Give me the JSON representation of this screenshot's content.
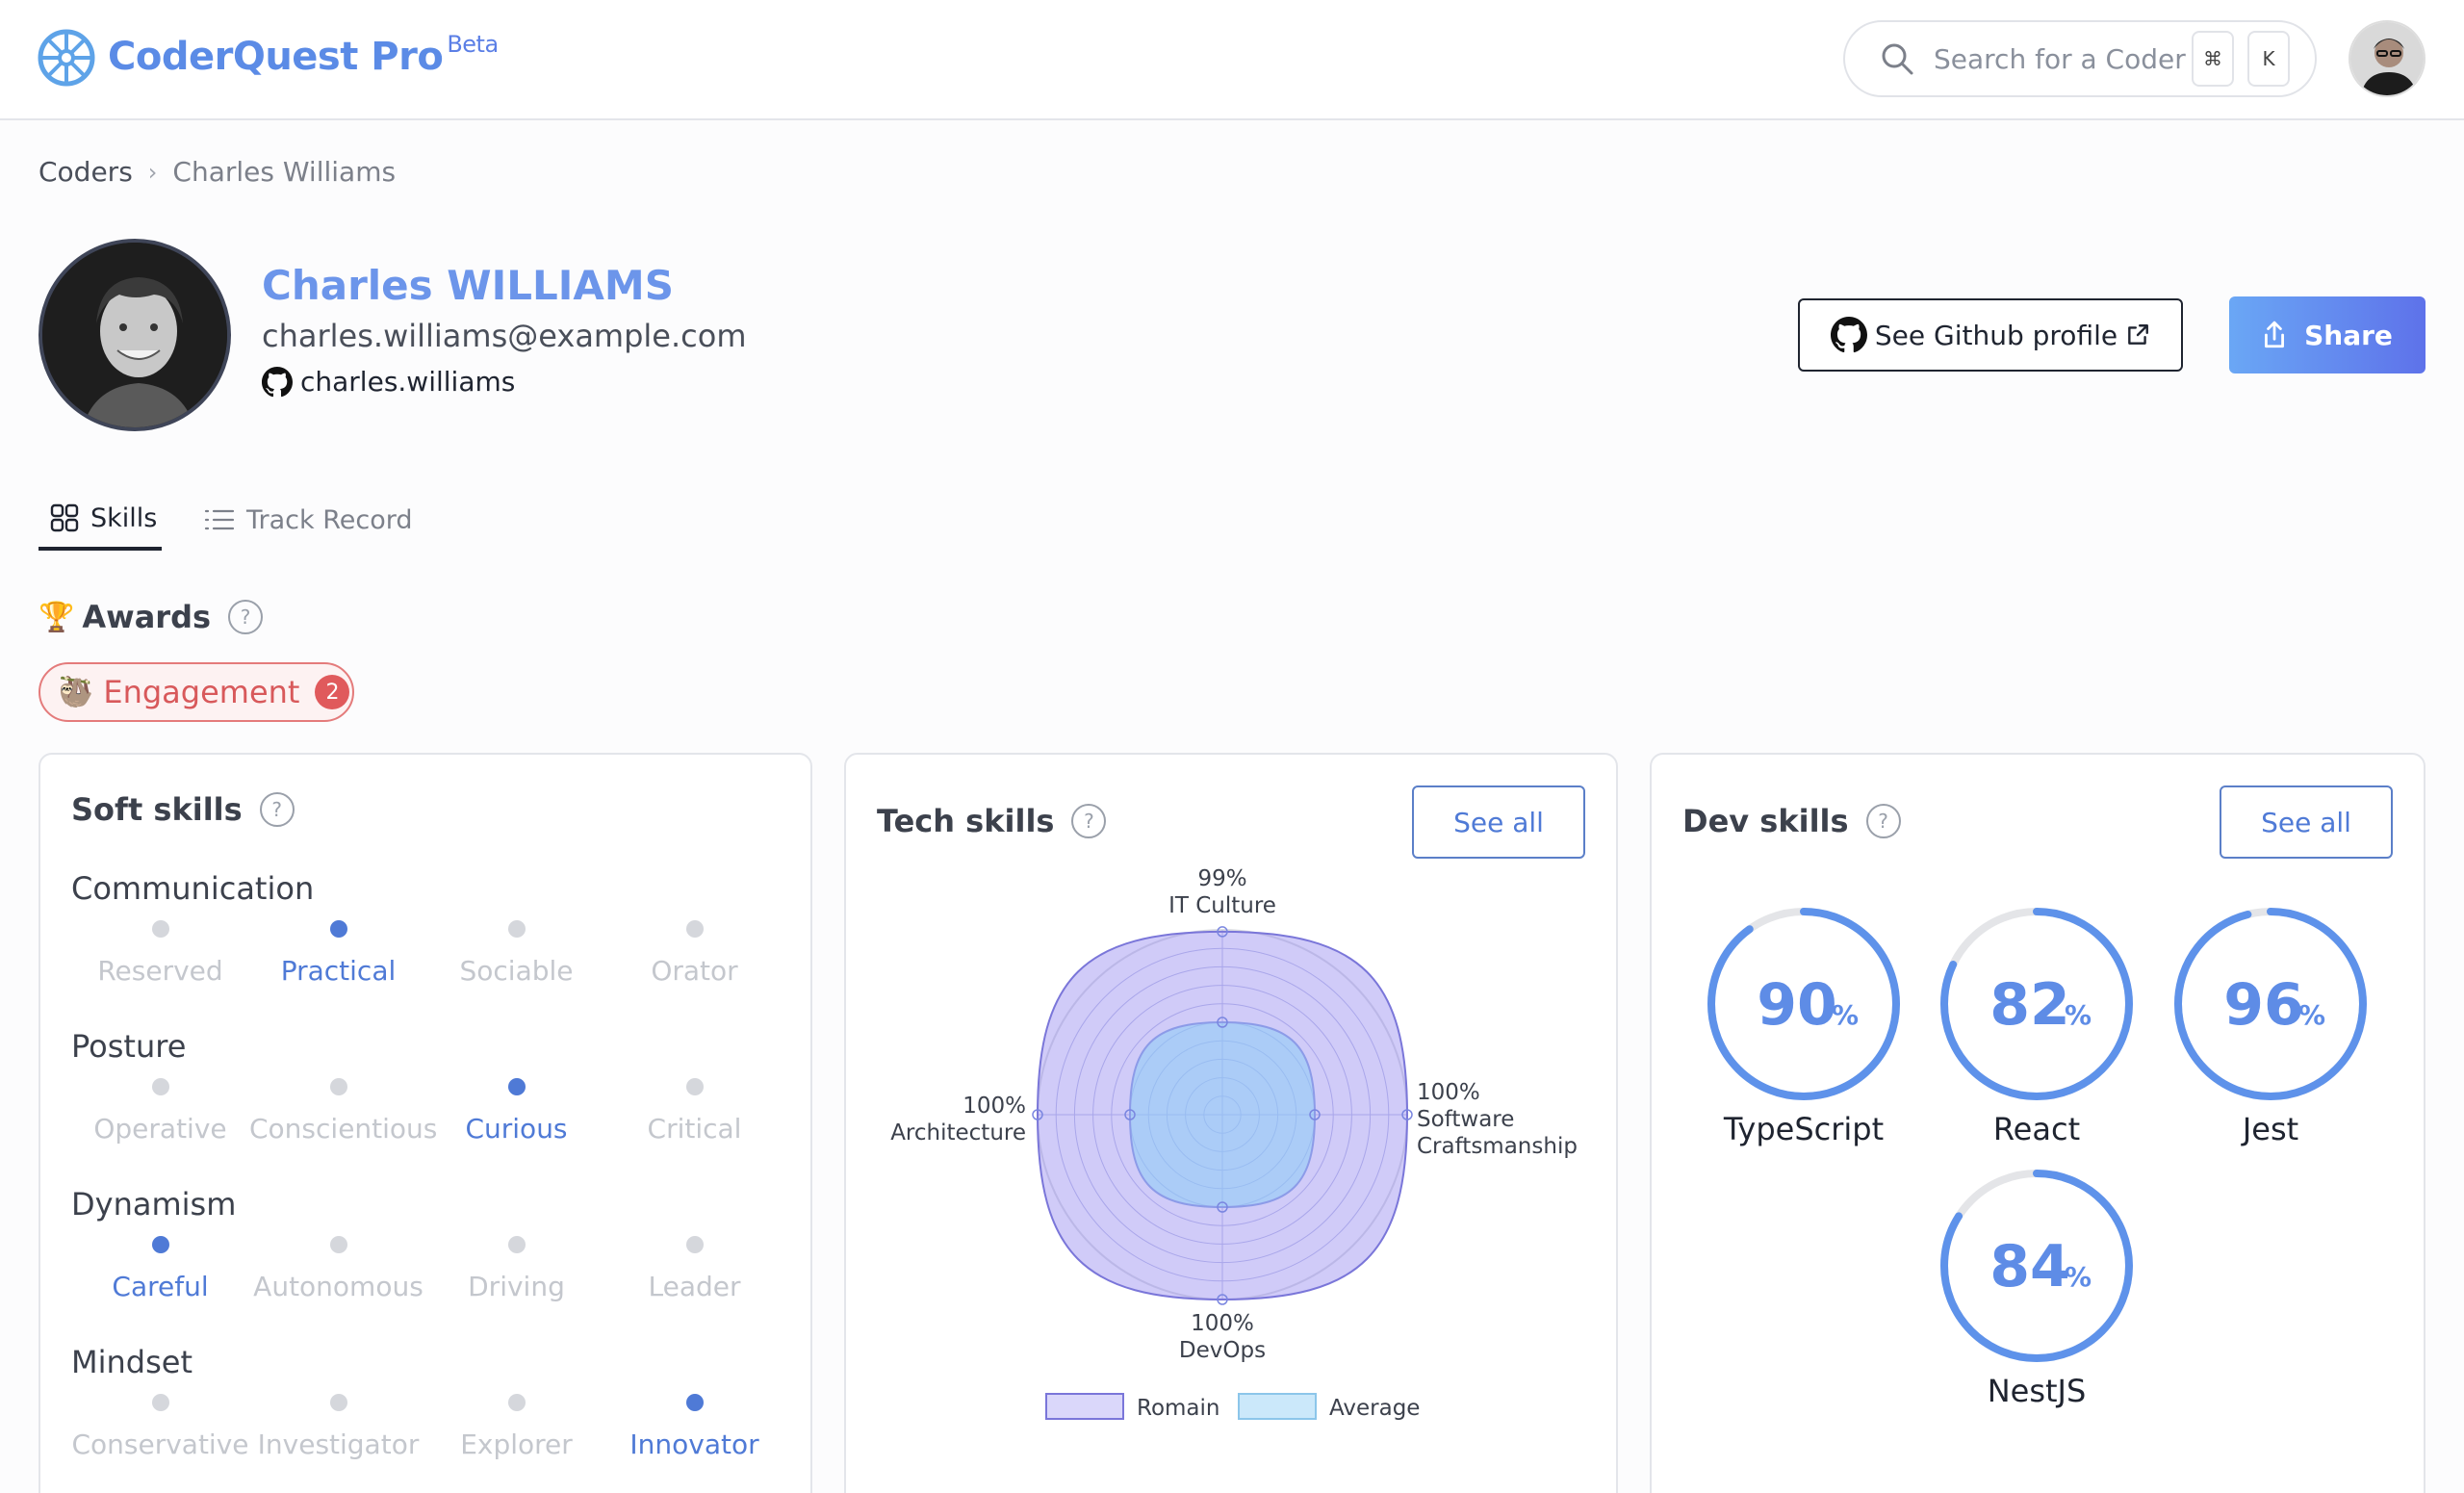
{
  "header": {
    "logo_text": "CoderQuest Pro",
    "logo_badge": "Beta",
    "search_placeholder": "Search for a Coder",
    "shortcut_key_1": "⌘",
    "shortcut_key_2": "K"
  },
  "breadcrumb": {
    "items": [
      "Coders",
      "Charles Williams"
    ],
    "separator": "›"
  },
  "profile": {
    "name": "Charles WILLIAMS",
    "email": "charles.williams@example.com",
    "github_username": "charles.williams",
    "github_button": "See Github profile",
    "share_button": "Share"
  },
  "tabs": [
    {
      "label": "Skills",
      "active": true
    },
    {
      "label": "Track Record",
      "active": false
    }
  ],
  "awards": {
    "title": "Awards",
    "badges": [
      {
        "label": "Engagement",
        "count": "2"
      }
    ]
  },
  "soft_skills": {
    "title": "Soft skills",
    "groups": [
      {
        "name": "Communication",
        "options": [
          "Reserved",
          "Practical",
          "Sociable",
          "Orator"
        ],
        "selected": 1
      },
      {
        "name": "Posture",
        "options": [
          "Operative",
          "Conscientious",
          "Curious",
          "Critical"
        ],
        "selected": 2
      },
      {
        "name": "Dynamism",
        "options": [
          "Careful",
          "Autonomous",
          "Driving",
          "Leader"
        ],
        "selected": 0
      },
      {
        "name": "Mindset",
        "options": [
          "Conservative",
          "Investigator",
          "Explorer",
          "Innovator"
        ],
        "selected": 3
      }
    ]
  },
  "tech_skills": {
    "title": "Tech skills",
    "see_all": "See all"
  },
  "dev_skills": {
    "title": "Dev skills",
    "see_all": "See all",
    "items": [
      {
        "name": "TypeScript",
        "value": 90,
        "display": "90"
      },
      {
        "name": "React",
        "value": 82,
        "display": "82"
      },
      {
        "name": "Jest",
        "value": 96,
        "display": "96"
      },
      {
        "name": "NestJS",
        "value": 84,
        "display": "84"
      }
    ],
    "unit": "%"
  },
  "colors": {
    "brand": "#5b8be6",
    "accent": "#4f7ad6",
    "award": "#d8595b",
    "radar_romain": "#c9c8f5",
    "radar_average": "#c7e4f7"
  },
  "chart_data": {
    "type": "radar",
    "axes": [
      {
        "name": "IT Culture",
        "label": "99%"
      },
      {
        "name": "Software Craftsmanship",
        "label": "100%"
      },
      {
        "name": "DevOps",
        "label": "100%"
      },
      {
        "name": "Architecture",
        "label": "100%"
      }
    ],
    "series": [
      {
        "name": "Romain",
        "values": [
          99,
          100,
          100,
          100
        ]
      },
      {
        "name": "Average",
        "values": [
          50,
          50,
          50,
          50
        ]
      }
    ],
    "range": [
      0,
      100
    ],
    "legend_position": "bottom"
  }
}
